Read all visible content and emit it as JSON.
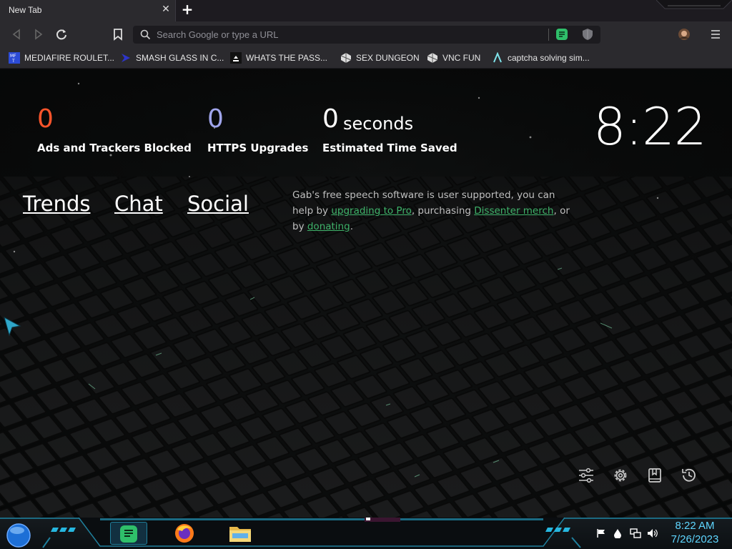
{
  "tab": {
    "title": "New Tab",
    "close_glyph": "✕",
    "new_tab_glyph": "+"
  },
  "toolbar": {
    "omnibox_placeholder": "Search Google or type a URL",
    "icons": [
      "back-icon",
      "forward-icon",
      "reload-icon",
      "bookmark-icon",
      "search-icon",
      "brave-talk-icon",
      "shield-icon",
      "profile-avatar",
      "menu-icon"
    ]
  },
  "bookmarks": [
    {
      "label": "MEDIAFIRE ROULET...",
      "icon": "mediafire-icon"
    },
    {
      "label": "SMASH GLASS IN C...",
      "icon": "smash-glass-icon"
    },
    {
      "label": "WHATS THE PASS...",
      "icon": "password-icon"
    },
    {
      "label": "SEX DUNGEON",
      "icon": "dungeon-icon"
    },
    {
      "label": "VNC FUN",
      "icon": "vnc-icon"
    },
    {
      "label": "captcha solving sim...",
      "icon": "captcha-icon"
    }
  ],
  "stats": {
    "ads": {
      "value": "0",
      "label": "Ads and Trackers Blocked",
      "color": "#fb542b"
    },
    "https": {
      "value": "0",
      "label": "HTTPS Upgrades",
      "color": "#a0a5eb"
    },
    "time": {
      "value": "0",
      "unit": "seconds",
      "label": "Estimated Time Saved",
      "color": "#ffffff"
    }
  },
  "clock": "8:22",
  "nav_links": [
    "Trends",
    "Chat",
    "Social"
  ],
  "gab": {
    "text1": "Gab's free speech software is user supported, you can help by ",
    "link1": "upgrading to Pro",
    "text2": ", purchasing ",
    "link2": "Dissenter merch",
    "text3": ", or by ",
    "link3": "donating",
    "text4": "."
  },
  "bottom_tools": [
    "customize-icon",
    "settings-icon",
    "bookmarks-icon",
    "history-icon"
  ],
  "taskbar": {
    "time": "8:22 AM",
    "date": "7/26/2023",
    "apps": [
      "sublime-text-icon",
      "firefox-icon",
      "file-explorer-icon"
    ],
    "tray_icons": [
      "flag-icon",
      "water-drop-icon",
      "network-icon",
      "volume-icon"
    ]
  },
  "colors": {
    "accent_green": "#3fb36a",
    "taskbar_accent": "#1b6a82",
    "clock_cyan": "#5fd6ff"
  }
}
